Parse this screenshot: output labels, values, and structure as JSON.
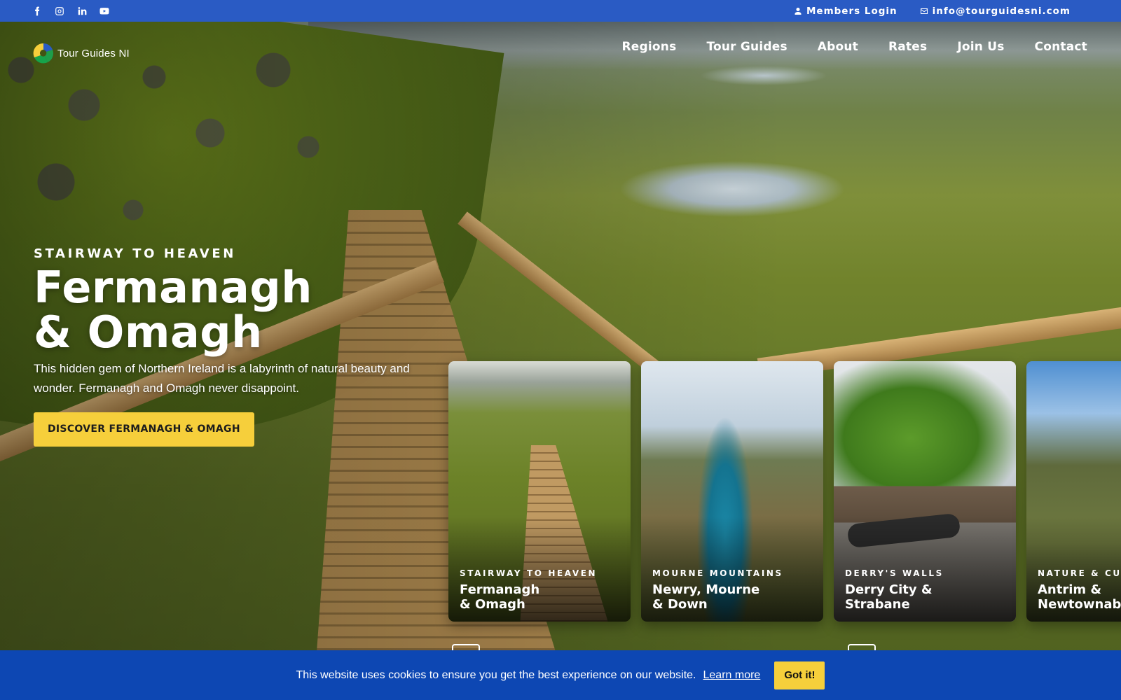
{
  "topbar": {
    "social": [
      {
        "icon": "facebook-icon"
      },
      {
        "icon": "instagram-icon"
      },
      {
        "icon": "linkedin-icon"
      },
      {
        "icon": "youtube-icon"
      }
    ],
    "members_login": "Members Login",
    "email": "info@tourguidesni.com"
  },
  "logo": {
    "text": "Tour Guides NI"
  },
  "nav": {
    "items": [
      "Regions",
      "Tour Guides",
      "About",
      "Rates",
      "Join Us",
      "Contact"
    ]
  },
  "hero": {
    "kicker": "STAIRWAY TO HEAVEN",
    "title_line1": "Fermanagh",
    "title_line2": "& Omagh",
    "description": "This hidden gem of Northern Ireland is a labyrinth of natural beauty and wonder. Fermanagh and Omagh never disappoint.",
    "cta": "DISCOVER FERMANAGH & OMAGH"
  },
  "cards": [
    {
      "tag": "STAIRWAY TO HEAVEN",
      "name": "Fermanagh\n& Omagh"
    },
    {
      "tag": "MOURNE MOUNTAINS",
      "name": "Newry, Mourne\n& Down"
    },
    {
      "tag": "DERRY'S WALLS",
      "name": "Derry City &\nStrabane"
    },
    {
      "tag": "NATURE & CUL",
      "name": "Antrim &\nNewtownabb"
    }
  ],
  "cookie": {
    "message": "This website uses cookies to ensure you get the best experience on our website.",
    "learn_more": "Learn more",
    "button": "Got it!"
  },
  "colors": {
    "topbar": "#2a5bc4",
    "cookie_bar": "#0d47b3",
    "accent_yellow": "#f6cf3b"
  }
}
